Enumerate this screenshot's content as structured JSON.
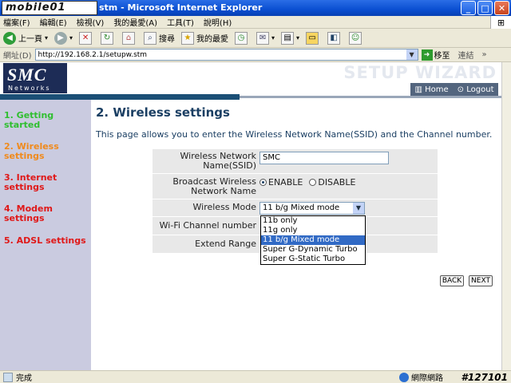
{
  "window": {
    "logo_text": "mobile01",
    "title": "stm - Microsoft Internet Explorer",
    "min": "_",
    "max": "□",
    "close": "✕"
  },
  "menu": [
    "檔案(F)",
    "編輯(E)",
    "檢視(V)",
    "我的最愛(A)",
    "工具(T)",
    "說明(H)"
  ],
  "toolbar": {
    "back": "上一頁",
    "search": "搜尋",
    "favorites": "我的最愛"
  },
  "address": {
    "label": "網址(D)",
    "url": "http://192.168.2.1/setupw.stm",
    "go": "移至",
    "links": "連結"
  },
  "header": {
    "brand": "SMC",
    "brand_sub": "Networks",
    "wizard_title": "SETUP WIZARD",
    "home": "Home",
    "logout": "Logout"
  },
  "sidebar": {
    "items": [
      {
        "label": "1. Getting started"
      },
      {
        "label": "2. Wireless settings"
      },
      {
        "label": "3. Internet settings"
      },
      {
        "label": "4. Modem settings"
      },
      {
        "label": "5. ADSL settings"
      }
    ]
  },
  "main": {
    "title": "2. Wireless settings",
    "intro": "This page allows you to enter the Wireless Network Name(SSID) and the Channel number."
  },
  "form": {
    "ssid_label": "Wireless Network Name(SSID)",
    "ssid_value": "SMC",
    "broadcast_label": "Broadcast Wireless Network Name",
    "enable_label": "ENABLE",
    "disable_label": "DISABLE",
    "broadcast_selected": "ENABLE",
    "mode_label": "Wireless Mode",
    "mode_value": "11 b/g Mixed mode",
    "channel_label": "Wi-Fi Channel number",
    "extend_label": "Extend Range",
    "mode_options": [
      "11b only",
      "11g only",
      "11 b/g Mixed mode",
      "Super G-Dynamic Turbo",
      "Super G-Static Turbo"
    ]
  },
  "buttons": {
    "back": "BACK",
    "next": "NEXT"
  },
  "status": {
    "text": "完成",
    "zone": "網際網路",
    "watermark": "#127101"
  }
}
